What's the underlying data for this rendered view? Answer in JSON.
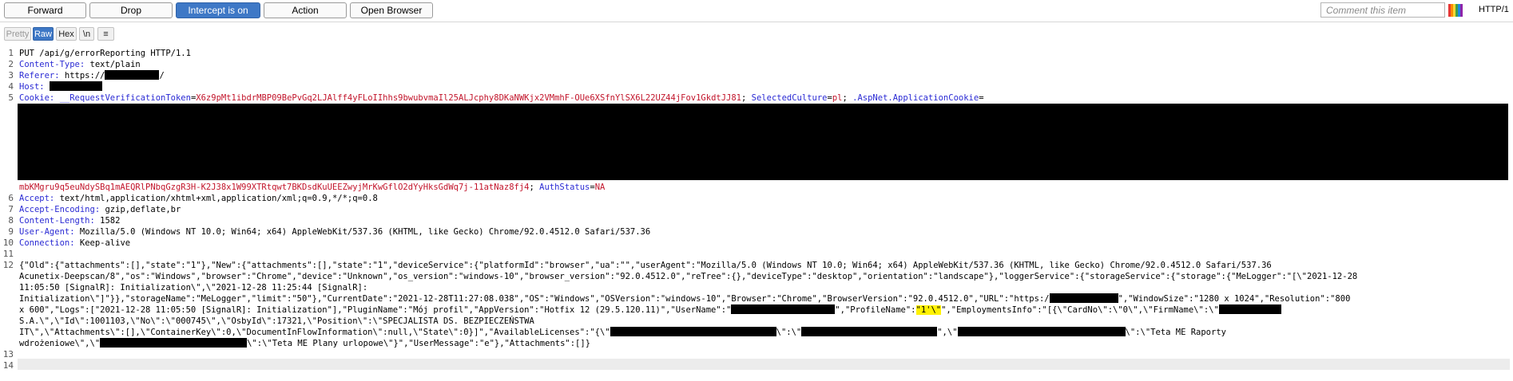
{
  "toolbar": {
    "forward": "Forward",
    "drop": "Drop",
    "intercept": "Intercept is on",
    "action": "Action",
    "open_browser": "Open Browser",
    "comment_placeholder": "Comment this item",
    "http_version": "HTTP/1"
  },
  "view": {
    "pretty": "Pretty",
    "raw": "Raw",
    "hex": "Hex",
    "newline": "\\n",
    "menu": "≡"
  },
  "lines": {
    "n1": "1",
    "n2": "2",
    "n3": "3",
    "n4": "4",
    "n5": "5",
    "n6": "6",
    "n7": "7",
    "n8": "8",
    "n9": "9",
    "n10": "10",
    "n11": "11",
    "n12": "12",
    "n13": "13",
    "n14": "14",
    "request_line": "PUT /api/g/errorReporting HTTP/1.1",
    "content_type_name": "Content-Type:",
    "content_type_value": " text/plain",
    "referer_name": "Referer:",
    "referer_value": " https://",
    "referer_tail": "/",
    "host_name": "Host:",
    "cookie_name": "Cookie:",
    "cookie_token_name": " __RequestVerificationToken",
    "cookie_token_value": "X6z9pMt1ibdrMBP09BePvGq2LJAlff4yFLoIIhhs9bwubvmaIl25ALJcphy8DKaNWKjx2VMmhF-OUe6XSfnYlSX6L22UZ44jFov1GkdtJJ81",
    "cookie_culture_name": " SelectedCulture",
    "cookie_culture_value": "pl",
    "cookie_app_name": " .AspNet.ApplicationCookie",
    "cookie_cont_value": "mbKMgru9q5euNdySBq1mAEQRlPNbqGzgR3H-K2J38x1W99XTRtqwt7BKDsdKuUEEZwyjMrKwGflO2dYyHksGdWq7j-11atNaz8fj4",
    "cookie_auth_name": " AuthStatus",
    "cookie_auth_value": "NA",
    "accept_name": "Accept:",
    "accept_value": " text/html,application/xhtml+xml,application/xml;q=0.9,*/*;q=0.8",
    "accept_enc_name": "Accept-Encoding:",
    "accept_enc_value": " gzip,deflate,br",
    "content_len_name": "Content-Length:",
    "content_len_value": " 1582",
    "ua_name": "User-Agent:",
    "ua_value": " Mozilla/5.0 (Windows NT 10.0; Win64; x64) AppleWebKit/537.36 (KHTML, like Gecko) Chrome/92.0.4512.0 Safari/537.36",
    "conn_name": "Connection:",
    "conn_value": " Keep-alive",
    "body1": "{\"Old\":{\"attachments\":[],\"state\":\"1\"},\"New\":{\"attachments\":[],\"state\":\"1\",\"deviceService\":{\"platformId\":\"browser\",\"ua\":\"\",\"userAgent\":\"Mozilla/5.0 (Windows NT 10.0; Win64; x64) AppleWebKit/537.36 (KHTML, like Gecko) Chrome/92.0.4512.0 Safari/537.36",
    "body2": "Acunetix-Deepscan/8\",\"os\":\"Windows\",\"browser\":\"Chrome\",\"device\":\"Unknown\",\"os_version\":\"windows-10\",\"browser_version\":\"92.0.4512.0\",\"reTree\":{},\"deviceType\":\"desktop\",\"orientation\":\"landscape\"},\"loggerService\":{\"storageService\":{\"storage\":{\"MeLogger\":\"[\\\"2021-12-28",
    "body3": "11:05:50 [SignalR]: Initialization\\\",\\\"2021-12-28 11:25:44 [SignalR]:",
    "body4": "Initialization\\\"]\"}},\"storageName\":\"MeLogger\",\"limit\":\"50\"},\"CurrentDate\":\"2021-12-28T11:27:08.038\",\"OS\":\"Windows\",\"OSVersion\":\"windows-10\",\"Browser\":\"Chrome\",\"BrowserVersion\":\"92.0.4512.0\",\"URL\":\"https:/",
    "body4_b": "\",\"WindowSize\":\"1280 x 1024\",\"Resolution\":\"800",
    "body5_a": "x 600\",\"Logs\":[\"2021-12-28 11:05:50 [SignalR]: Initialization\"],\"PluginName\":\"Mój profil\",\"AppVersion\":\"Hotfix 12 (29.5.120.11)\",\"UserName\":\"",
    "body5_b": "\",\"ProfileName\":",
    "body5_hl": "\"1'\\\"",
    "body5_c": "\",\"EmploymentsInfo\":\"[{\\\"CardNo\\\":\\\"0\\\",\\\"FirmName\\\":\\\"",
    "body6_a": "S.A.\\\",\\\"Id\\\":1001103,\\\"No\\\":\\\"000745\\\",\\\"OsbyId\\\":17321,\\\"Position\\\":\\\"SPECJALISTA DS. BEZPIECZEŃSTWA",
    "body7_a": "IT\\\",\\\"Attachments\\\":[],\\\"ContainerKey\\\":0,\\\"DocumentInFlowInformation\\\":null,\\\"State\\\":0}]\",\"AvailableLicenses\":\"{\\\"",
    "body7_b": "\\\":\\\"",
    "body7_c": "\",\\\"",
    "body7_d": "\\\":\\\"Teta ME Raporty",
    "body8_a": "wdrożeniowe\\\",\\\"",
    "body8_b": "\\\":\\\"Teta ME Plany urlopowe\\\"}\",\"UserMessage\":\"e\"},\"Attachments\":[]}"
  }
}
